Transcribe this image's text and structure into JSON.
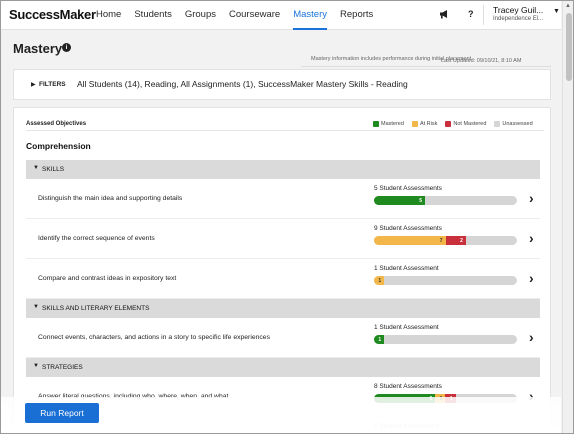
{
  "app": {
    "logo": "SuccessMaker",
    "nav": [
      {
        "label": "Home",
        "active": false
      },
      {
        "label": "Students",
        "active": false
      },
      {
        "label": "Groups",
        "active": false
      },
      {
        "label": "Courseware",
        "active": false
      },
      {
        "label": "Mastery",
        "active": true
      },
      {
        "label": "Reports",
        "active": false
      }
    ],
    "icons": {
      "announcements": "megaphone-icon",
      "help": "?"
    },
    "user": {
      "name": "Tracey Guil...",
      "school": "Independence El..."
    }
  },
  "page": {
    "title": "Mastery",
    "info_note": "Mastery information includes performance during initial placement",
    "last_updated": "Last Updated: 09/10/21, 8:10 AM"
  },
  "filters": {
    "label": "FILTERS",
    "summary": "All Students (14), Reading, All Assignments (1), SuccessMaker Mastery Skills - Reading"
  },
  "report": {
    "assessed_label": "Assessed Objectives",
    "legend": [
      {
        "label": "Mastered",
        "color": "#1f8a1f"
      },
      {
        "label": "At Risk",
        "color": "#f3b648"
      },
      {
        "label": "Not Mastered",
        "color": "#c9303c"
      },
      {
        "label": "Unassessed",
        "color": "#d5d5d5"
      }
    ],
    "domain": "Comprehension",
    "sections": [
      {
        "title": "SKILLS",
        "rows": [
          {
            "objective": "Distinguish the main idea and supporting details",
            "count": "5 Student Assessments",
            "mastered": 5,
            "at_risk": 0,
            "not_mastered": 0,
            "total": 14
          },
          {
            "objective": "Identify the correct sequence of events",
            "count": "9 Student Assessments",
            "mastered": 0,
            "at_risk": 7,
            "not_mastered": 2,
            "total": 14
          },
          {
            "objective": "Compare and contrast ideas in expository text",
            "count": "1 Student Assessment",
            "mastered": 0,
            "at_risk": 1,
            "not_mastered": 0,
            "total": 14
          }
        ]
      },
      {
        "title": "SKILLS AND LITERARY ELEMENTS",
        "rows": [
          {
            "objective": "Connect events, characters, and actions in a story to specific life experiences",
            "count": "1 Student Assessment",
            "mastered": 1,
            "at_risk": 0,
            "not_mastered": 0,
            "total": 14
          }
        ]
      },
      {
        "title": "STRATEGIES",
        "rows": [
          {
            "objective": "Answer literal questions, including who, where, when, and what",
            "count": "8 Student Assessments",
            "mastered": 6,
            "at_risk": 1,
            "not_mastered": 1,
            "total": 14
          },
          {
            "objective": "",
            "count": "1 Student Assessment",
            "mastered": 0,
            "at_risk": 0,
            "not_mastered": 0,
            "total": 14
          }
        ]
      }
    ],
    "run_report": "Run Report"
  }
}
